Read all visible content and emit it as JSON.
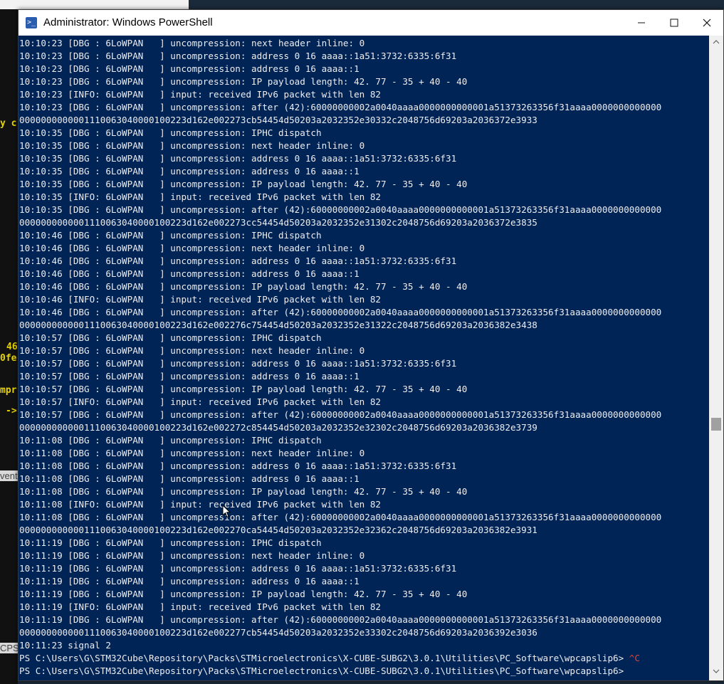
{
  "window": {
    "title": "Administrator: Windows PowerShell"
  },
  "background": {
    "fragments": [
      "y c",
      "46",
      "0fe",
      "mpr",
      "->",
      "vents",
      "CPS"
    ]
  },
  "console": {
    "lines": [
      "10:10:23 [DBG : 6LoWPAN   ] uncompression: next header inline: 0",
      "10:10:23 [DBG : 6LoWPAN   ] uncompression: address 0 16 aaaa::1a51:3732:6335:6f31",
      "10:10:23 [DBG : 6LoWPAN   ] uncompression: address 0 16 aaaa::1",
      "10:10:23 [DBG : 6LoWPAN   ] uncompression: IP payload length: 42. 77 - 35 + 40 - 40",
      "10:10:23 [INFO: 6LoWPAN   ] input: received IPv6 packet with len 82",
      "10:10:23 [DBG : 6LoWPAN   ] uncompression: after (42):60000000002a0040aaaa0000000000001a51373263356f31aaaa0000000000000",
      "0000000000001110063040000100223d162e002273cb54454d50203a2032352e30332c2048756d69203a2036372e3933",
      "10:10:35 [DBG : 6LoWPAN   ] uncompression: IPHC dispatch",
      "10:10:35 [DBG : 6LoWPAN   ] uncompression: next header inline: 0",
      "10:10:35 [DBG : 6LoWPAN   ] uncompression: address 0 16 aaaa::1a51:3732:6335:6f31",
      "10:10:35 [DBG : 6LoWPAN   ] uncompression: address 0 16 aaaa::1",
      "10:10:35 [DBG : 6LoWPAN   ] uncompression: IP payload length: 42. 77 - 35 + 40 - 40",
      "10:10:35 [INFO: 6LoWPAN   ] input: received IPv6 packet with len 82",
      "10:10:35 [DBG : 6LoWPAN   ] uncompression: after (42):60000000002a0040aaaa0000000000001a51373263356f31aaaa0000000000000",
      "0000000000001110063040000100223d162e002273cc54454d50203a2032352e31302c2048756d69203a2036372e3835",
      "10:10:46 [DBG : 6LoWPAN   ] uncompression: IPHC dispatch",
      "10:10:46 [DBG : 6LoWPAN   ] uncompression: next header inline: 0",
      "10:10:46 [DBG : 6LoWPAN   ] uncompression: address 0 16 aaaa::1a51:3732:6335:6f31",
      "10:10:46 [DBG : 6LoWPAN   ] uncompression: address 0 16 aaaa::1",
      "10:10:46 [DBG : 6LoWPAN   ] uncompression: IP payload length: 42. 77 - 35 + 40 - 40",
      "10:10:46 [INFO: 6LoWPAN   ] input: received IPv6 packet with len 82",
      "10:10:46 [DBG : 6LoWPAN   ] uncompression: after (42):60000000002a0040aaaa0000000000001a51373263356f31aaaa0000000000000",
      "0000000000001110063040000100223d162e002276c754454d50203a2032352e31322c2048756d69203a2036382e3438",
      "10:10:57 [DBG : 6LoWPAN   ] uncompression: IPHC dispatch",
      "10:10:57 [DBG : 6LoWPAN   ] uncompression: next header inline: 0",
      "10:10:57 [DBG : 6LoWPAN   ] uncompression: address 0 16 aaaa::1a51:3732:6335:6f31",
      "10:10:57 [DBG : 6LoWPAN   ] uncompression: address 0 16 aaaa::1",
      "10:10:57 [DBG : 6LoWPAN   ] uncompression: IP payload length: 42. 77 - 35 + 40 - 40",
      "10:10:57 [INFO: 6LoWPAN   ] input: received IPv6 packet with len 82",
      "10:10:57 [DBG : 6LoWPAN   ] uncompression: after (42):60000000002a0040aaaa0000000000001a51373263356f31aaaa0000000000000",
      "0000000000001110063040000100223d162e002272c854454d50203a2032352e32302c2048756d69203a2036382e3739",
      "10:11:08 [DBG : 6LoWPAN   ] uncompression: IPHC dispatch",
      "10:11:08 [DBG : 6LoWPAN   ] uncompression: next header inline: 0",
      "10:11:08 [DBG : 6LoWPAN   ] uncompression: address 0 16 aaaa::1a51:3732:6335:6f31",
      "10:11:08 [DBG : 6LoWPAN   ] uncompression: address 0 16 aaaa::1",
      "10:11:08 [DBG : 6LoWPAN   ] uncompression: IP payload length: 42. 77 - 35 + 40 - 40",
      "10:11:08 [INFO: 6LoWPAN   ] input: received IPv6 packet with len 82",
      "10:11:08 [DBG : 6LoWPAN   ] uncompression: after (42):60000000002a0040aaaa0000000000001a51373263356f31aaaa0000000000000",
      "0000000000001110063040000100223d162e002270ca54454d50203a2032352e32362c2048756d69203a2036382e3931",
      "10:11:19 [DBG : 6LoWPAN   ] uncompression: IPHC dispatch",
      "10:11:19 [DBG : 6LoWPAN   ] uncompression: next header inline: 0",
      "10:11:19 [DBG : 6LoWPAN   ] uncompression: address 0 16 aaaa::1a51:3732:6335:6f31",
      "10:11:19 [DBG : 6LoWPAN   ] uncompression: address 0 16 aaaa::1",
      "10:11:19 [DBG : 6LoWPAN   ] uncompression: IP payload length: 42. 77 - 35 + 40 - 40",
      "10:11:19 [INFO: 6LoWPAN   ] input: received IPv6 packet with len 82",
      "10:11:19 [DBG : 6LoWPAN   ] uncompression: after (42):60000000002a0040aaaa0000000000001a51373263356f31aaaa0000000000000",
      "0000000000001110063040000100223d162e002277cb54454d50203a2032352e33302c2048756d69203a2036392e3036",
      "10:11:23 signal 2"
    ],
    "prompt_1": "PS C:\\Users\\G\\STM32Cube\\Repository\\Packs\\STMicroelectronics\\X-CUBE-SUBG2\\3.0.1\\Utilities\\PC_Software\\wpcapslip6> ",
    "ctrl_c": "^C",
    "prompt_2": "PS C:\\Users\\G\\STM32Cube\\Repository\\Packs\\STMicroelectronics\\X-CUBE-SUBG2\\3.0.1\\Utilities\\PC_Software\\wpcapslip6>"
  },
  "colors": {
    "console_bg": "#012456",
    "console_fg": "#eeedf0",
    "ctrl_c": "#e34234"
  },
  "icons": {
    "app": "powershell-icon",
    "minimize": "minimize-icon",
    "maximize": "maximize-icon",
    "close": "close-icon"
  }
}
